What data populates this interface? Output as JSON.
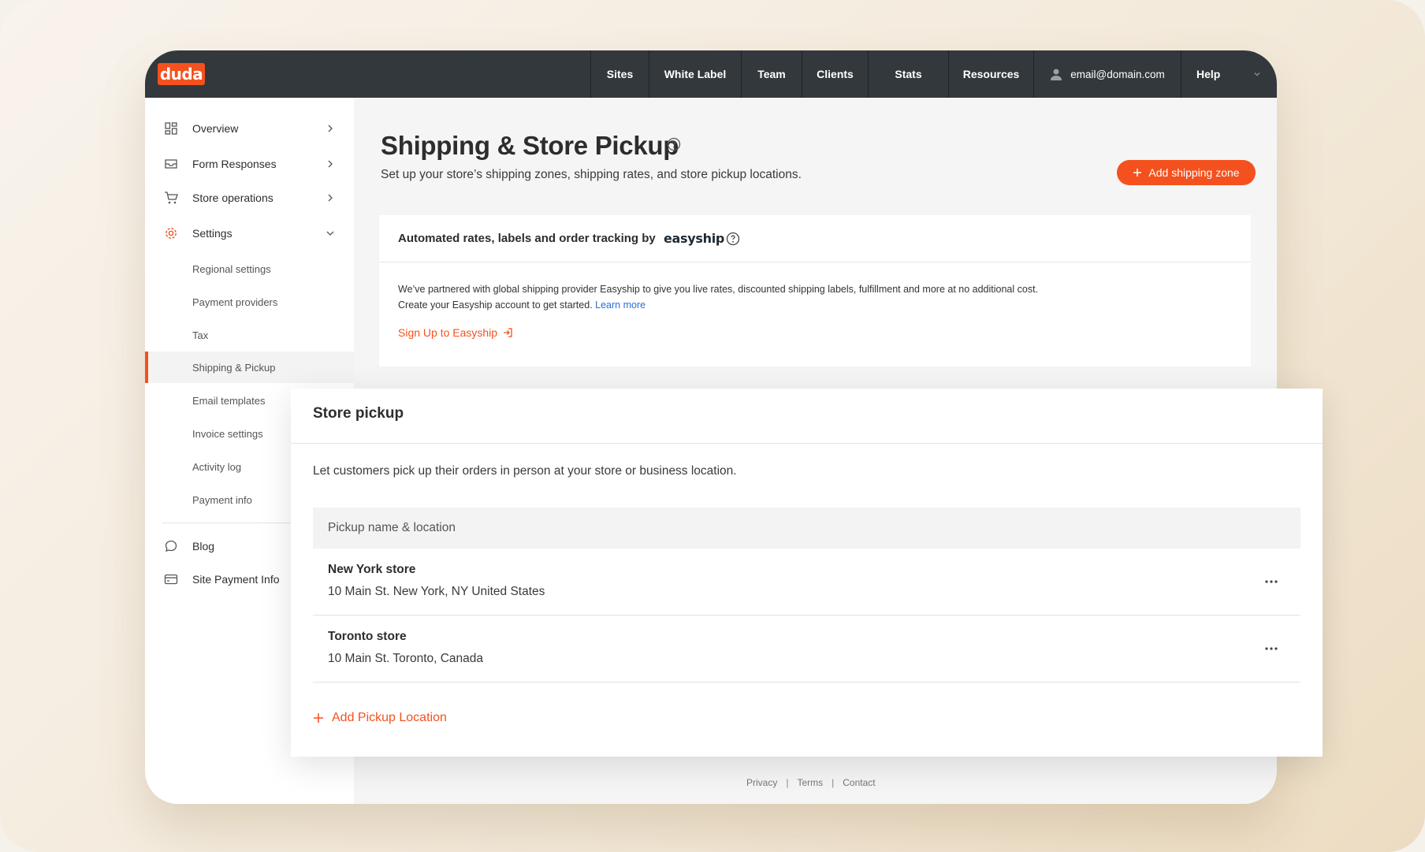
{
  "brand": {
    "logo_text": "duda",
    "accent": "#f4511e",
    "topbar_bg": "#33383c"
  },
  "topnav": {
    "items": [
      {
        "label": "Sites"
      },
      {
        "label": "White Label"
      },
      {
        "label": "Team"
      },
      {
        "label": "Clients"
      },
      {
        "label": "Stats"
      },
      {
        "label": "Resources"
      }
    ],
    "account_email": "email@domain.com",
    "help_label": "Help"
  },
  "sidebar": {
    "items": [
      {
        "label": "Overview",
        "icon": "grid-icon"
      },
      {
        "label": "Form Responses",
        "icon": "inbox-icon"
      },
      {
        "label": "Store operations",
        "icon": "cart-icon"
      },
      {
        "label": "Settings",
        "icon": "gear-icon"
      }
    ],
    "settings_sub": [
      {
        "label": "Regional settings"
      },
      {
        "label": "Payment providers"
      },
      {
        "label": "Tax"
      },
      {
        "label": "Shipping & Pickup"
      },
      {
        "label": "Email templates"
      },
      {
        "label": "Invoice settings"
      },
      {
        "label": "Activity log"
      },
      {
        "label": "Payment info"
      }
    ],
    "active_sub": "Shipping & Pickup",
    "bottom": [
      {
        "label": "Blog",
        "icon": "chat-icon"
      },
      {
        "label": "Site Payment Info",
        "icon": "card-icon"
      }
    ]
  },
  "page": {
    "title": "Shipping & Store Pickup",
    "subtitle": "Set up your store’s shipping zones, shipping rates, and store pickup locations.",
    "add_zone_label": "Add shipping zone"
  },
  "easyship": {
    "header": "Automated rates, labels and order tracking by",
    "brand": "easyship",
    "line1": "We’ve partnered with global shipping provider Easyship to give you live rates, discounted shipping labels, fulfillment and more at no additional cost.",
    "line2": "Create your Easyship account to get started.",
    "learn_more": "Learn more",
    "signup_label": "Sign Up to Easyship"
  },
  "store_pickup": {
    "title": "Store pickup",
    "description": "Let customers pick up their orders in person at your store or business location.",
    "column_header": "Pickup name & location",
    "locations": [
      {
        "name": "New York store",
        "address": "10 Main St. New York, NY United States"
      },
      {
        "name": "Toronto store",
        "address": "10 Main St. Toronto, Canada"
      }
    ],
    "add_label": "Add Pickup Location"
  },
  "footer": {
    "privacy": "Privacy",
    "terms": "Terms",
    "contact": "Contact"
  }
}
